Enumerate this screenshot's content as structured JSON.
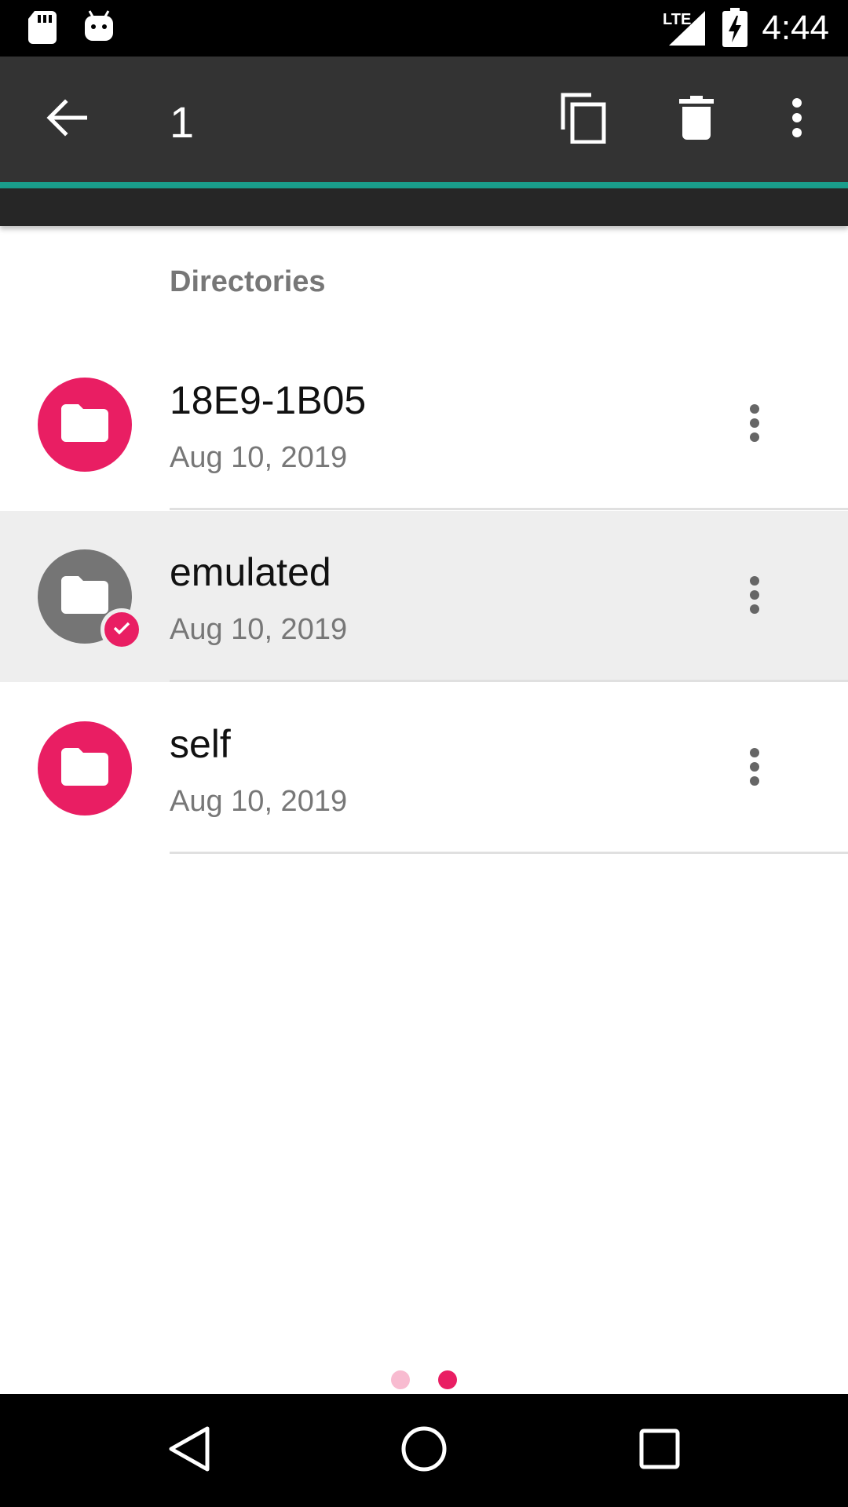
{
  "status_bar": {
    "time": "4:44",
    "network_label": "LTE",
    "icons": [
      "sd-card-icon",
      "android-icon",
      "signal-icon",
      "battery-charging-icon"
    ]
  },
  "toolbar": {
    "selection_count": "1",
    "icons": [
      "back-arrow-icon",
      "copy-icon",
      "delete-icon",
      "more-vert-icon"
    ]
  },
  "section": {
    "header": "Directories"
  },
  "items": [
    {
      "name": "18E9-1B05",
      "date": "Aug 10, 2019",
      "selected": false
    },
    {
      "name": "emulated",
      "date": "Aug 10, 2019",
      "selected": true
    },
    {
      "name": "self",
      "date": "Aug 10, 2019",
      "selected": false
    }
  ],
  "pager": {
    "pages": 2,
    "current": 2
  },
  "colors": {
    "accent": "#e91e63",
    "accent_light": "#f8bbd0",
    "toolbar": "#333333",
    "tab_indicator": "#1a9e8c",
    "selected_avatar": "#757575",
    "selected_row": "#eeeeee"
  },
  "nav_bar": {
    "icons": [
      "back-triangle-icon",
      "home-circle-icon",
      "recents-square-icon"
    ]
  }
}
